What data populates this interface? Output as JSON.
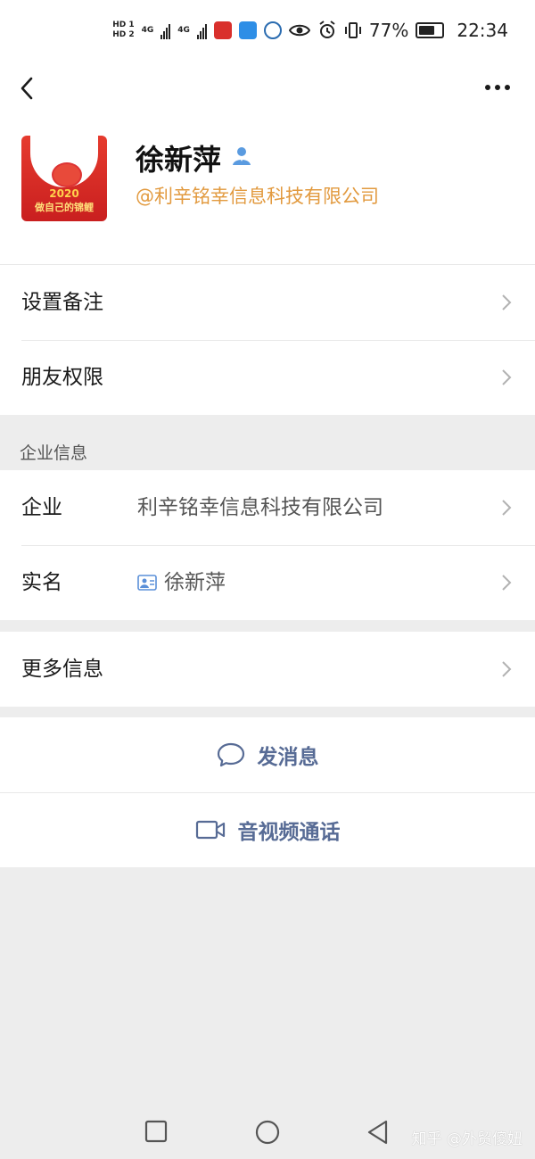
{
  "status_bar": {
    "hd1": "HD 1",
    "hd2": "HD 2",
    "net1": "4G",
    "net2": "4G",
    "battery_percent": "77%",
    "battery_level": 0.77,
    "time": "22:34"
  },
  "profile": {
    "name": "徐新萍",
    "company_tag": "@利辛铭幸信息科技有限公司",
    "avatar": {
      "year": "2020",
      "slogan": "做自己的锦鲤"
    }
  },
  "rows_top": [
    {
      "label": "设置备注"
    },
    {
      "label": "朋友权限"
    }
  ],
  "enterprise_section": {
    "title": "企业信息",
    "rows": [
      {
        "label": "企业",
        "value": "利辛铭幸信息科技有限公司"
      },
      {
        "label": "实名",
        "value": "徐新萍"
      }
    ]
  },
  "more_info": {
    "label": "更多信息"
  },
  "actions": {
    "message": "发消息",
    "video_call": "音视频通话"
  },
  "watermark": "知乎 @外贸傻妞",
  "colors": {
    "accent_link": "#576b95",
    "company_tag": "#e29a3f",
    "background": "#ededed"
  }
}
